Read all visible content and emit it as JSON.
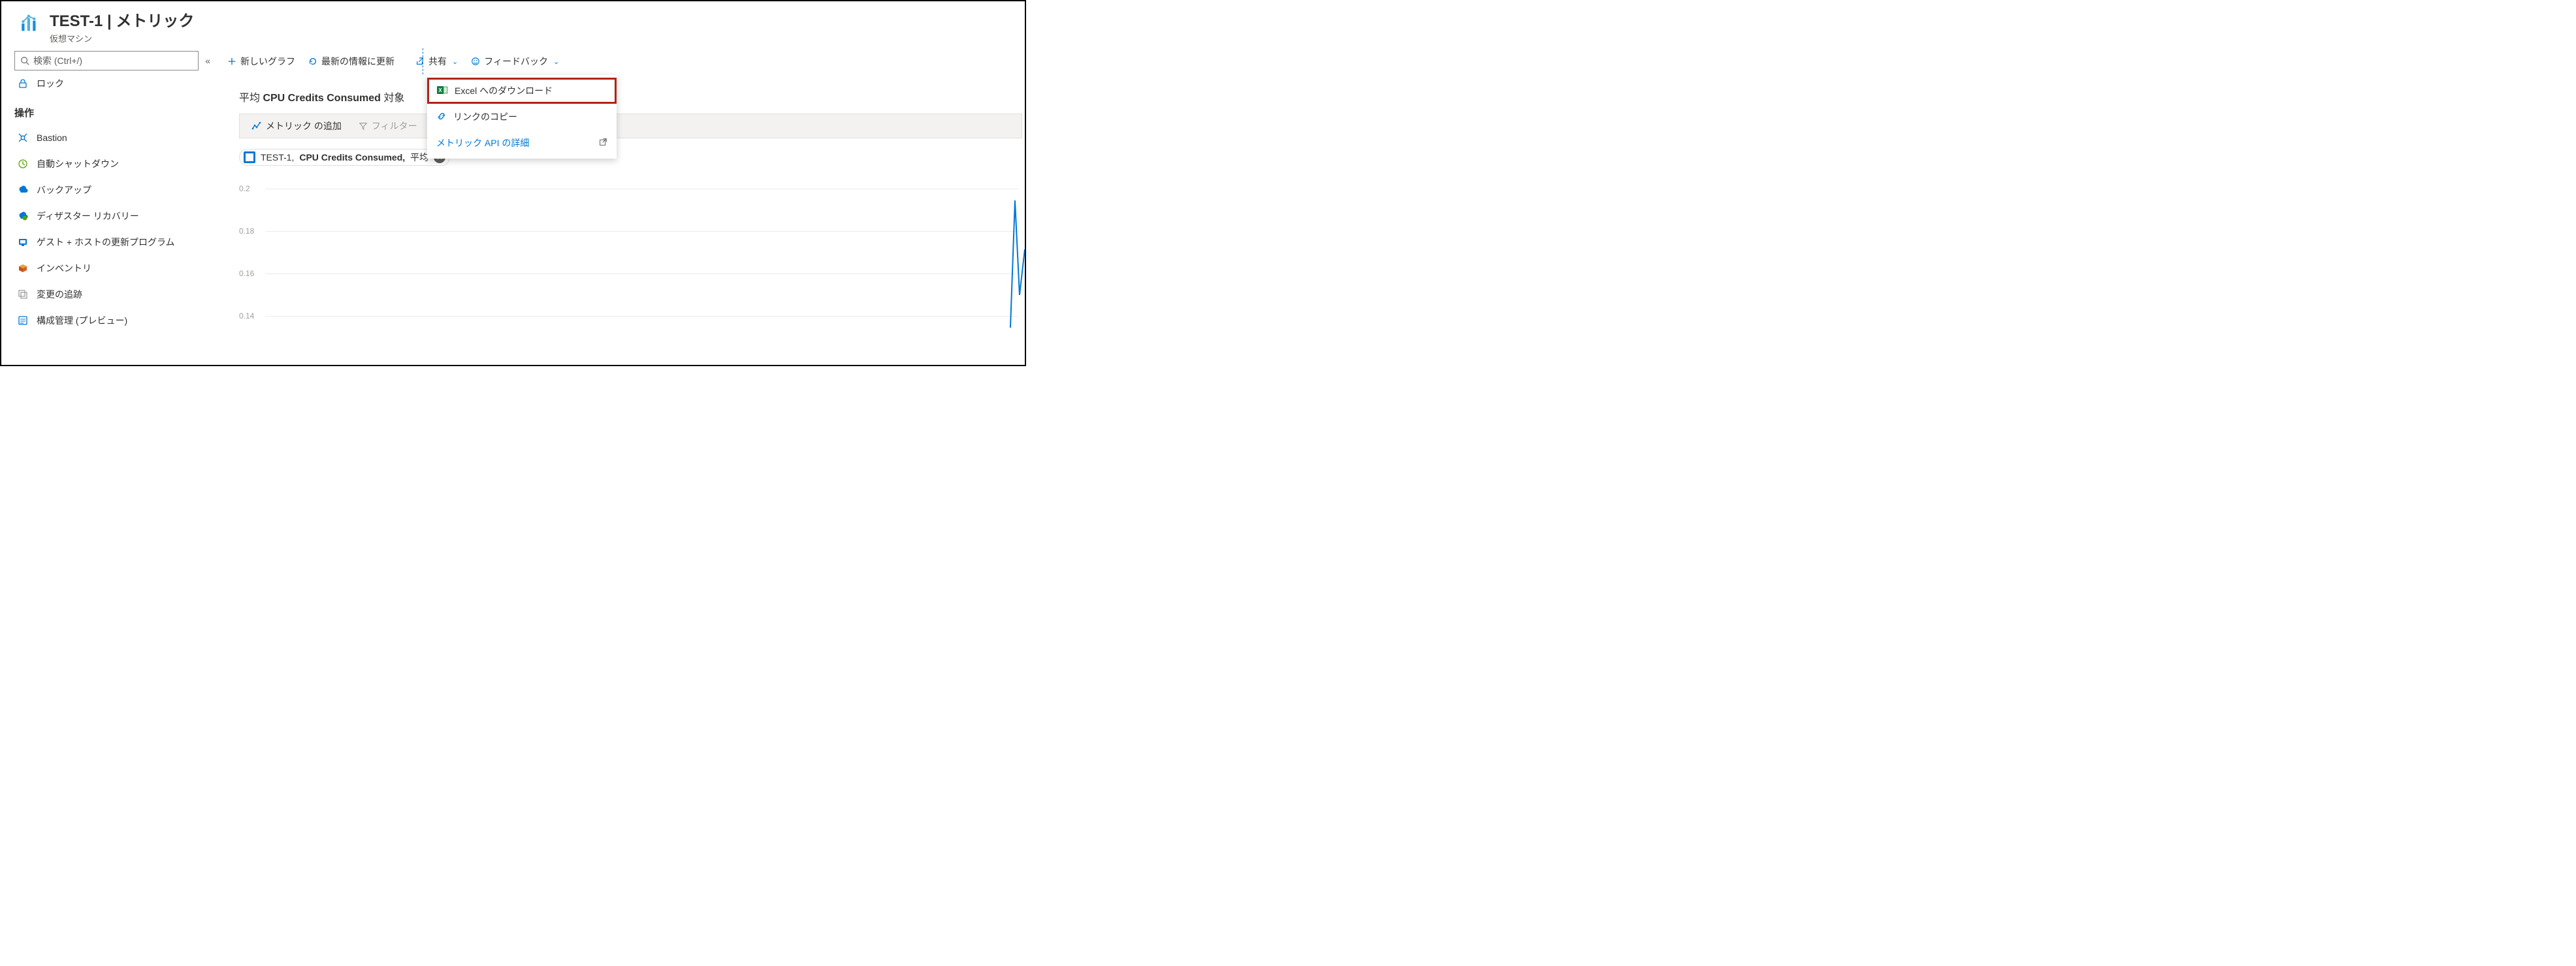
{
  "header": {
    "title": "TEST-1 | メトリック",
    "subtitle": "仮想マシン"
  },
  "search": {
    "placeholder": "検索 (Ctrl+/)"
  },
  "sidebar": {
    "lock": "ロック",
    "section_label": "操作",
    "items": [
      {
        "name": "bastion",
        "label": "Bastion"
      },
      {
        "name": "auto-shutdown",
        "label": "自動シャットダウン"
      },
      {
        "name": "backup",
        "label": "バックアップ"
      },
      {
        "name": "dr",
        "label": "ディザスター リカバリー"
      },
      {
        "name": "guest-host-update",
        "label": "ゲスト + ホストの更新プログラム"
      },
      {
        "name": "inventory",
        "label": "インベントリ"
      },
      {
        "name": "change-tracking",
        "label": "変更の追跡"
      },
      {
        "name": "config-mgmt",
        "label": "構成管理 (プレビュー)"
      }
    ]
  },
  "toolbar": {
    "new_chart": "新しいグラフ",
    "refresh": "最新の情報に更新",
    "share": "共有",
    "feedback": "フィードバック"
  },
  "share_menu": {
    "excel": "Excel へのダウンロード",
    "copy_link": "リンクのコピー",
    "api_details": "メトリック API の詳細"
  },
  "chart": {
    "title_prefix": "平均 ",
    "title_metric": "CPU Credits Consumed",
    "title_suffix": " 対象",
    "add_metric": "メトリック の追加",
    "add_filter": "フィルター",
    "pill_resource": "TEST-1",
    "pill_metric": "CPU Credits Consumed",
    "pill_agg": "平均"
  },
  "chart_data": {
    "type": "line",
    "ylabel": "",
    "ylim": [
      0.12,
      0.21
    ],
    "y_ticks": [
      0.2,
      0.18,
      0.16,
      0.14
    ],
    "series": [
      {
        "name": "TEST-1 CPU Credits Consumed 平均",
        "color": "#0078d4",
        "note": "only tail spike visible at right edge, peaks above ~0.19"
      }
    ]
  }
}
